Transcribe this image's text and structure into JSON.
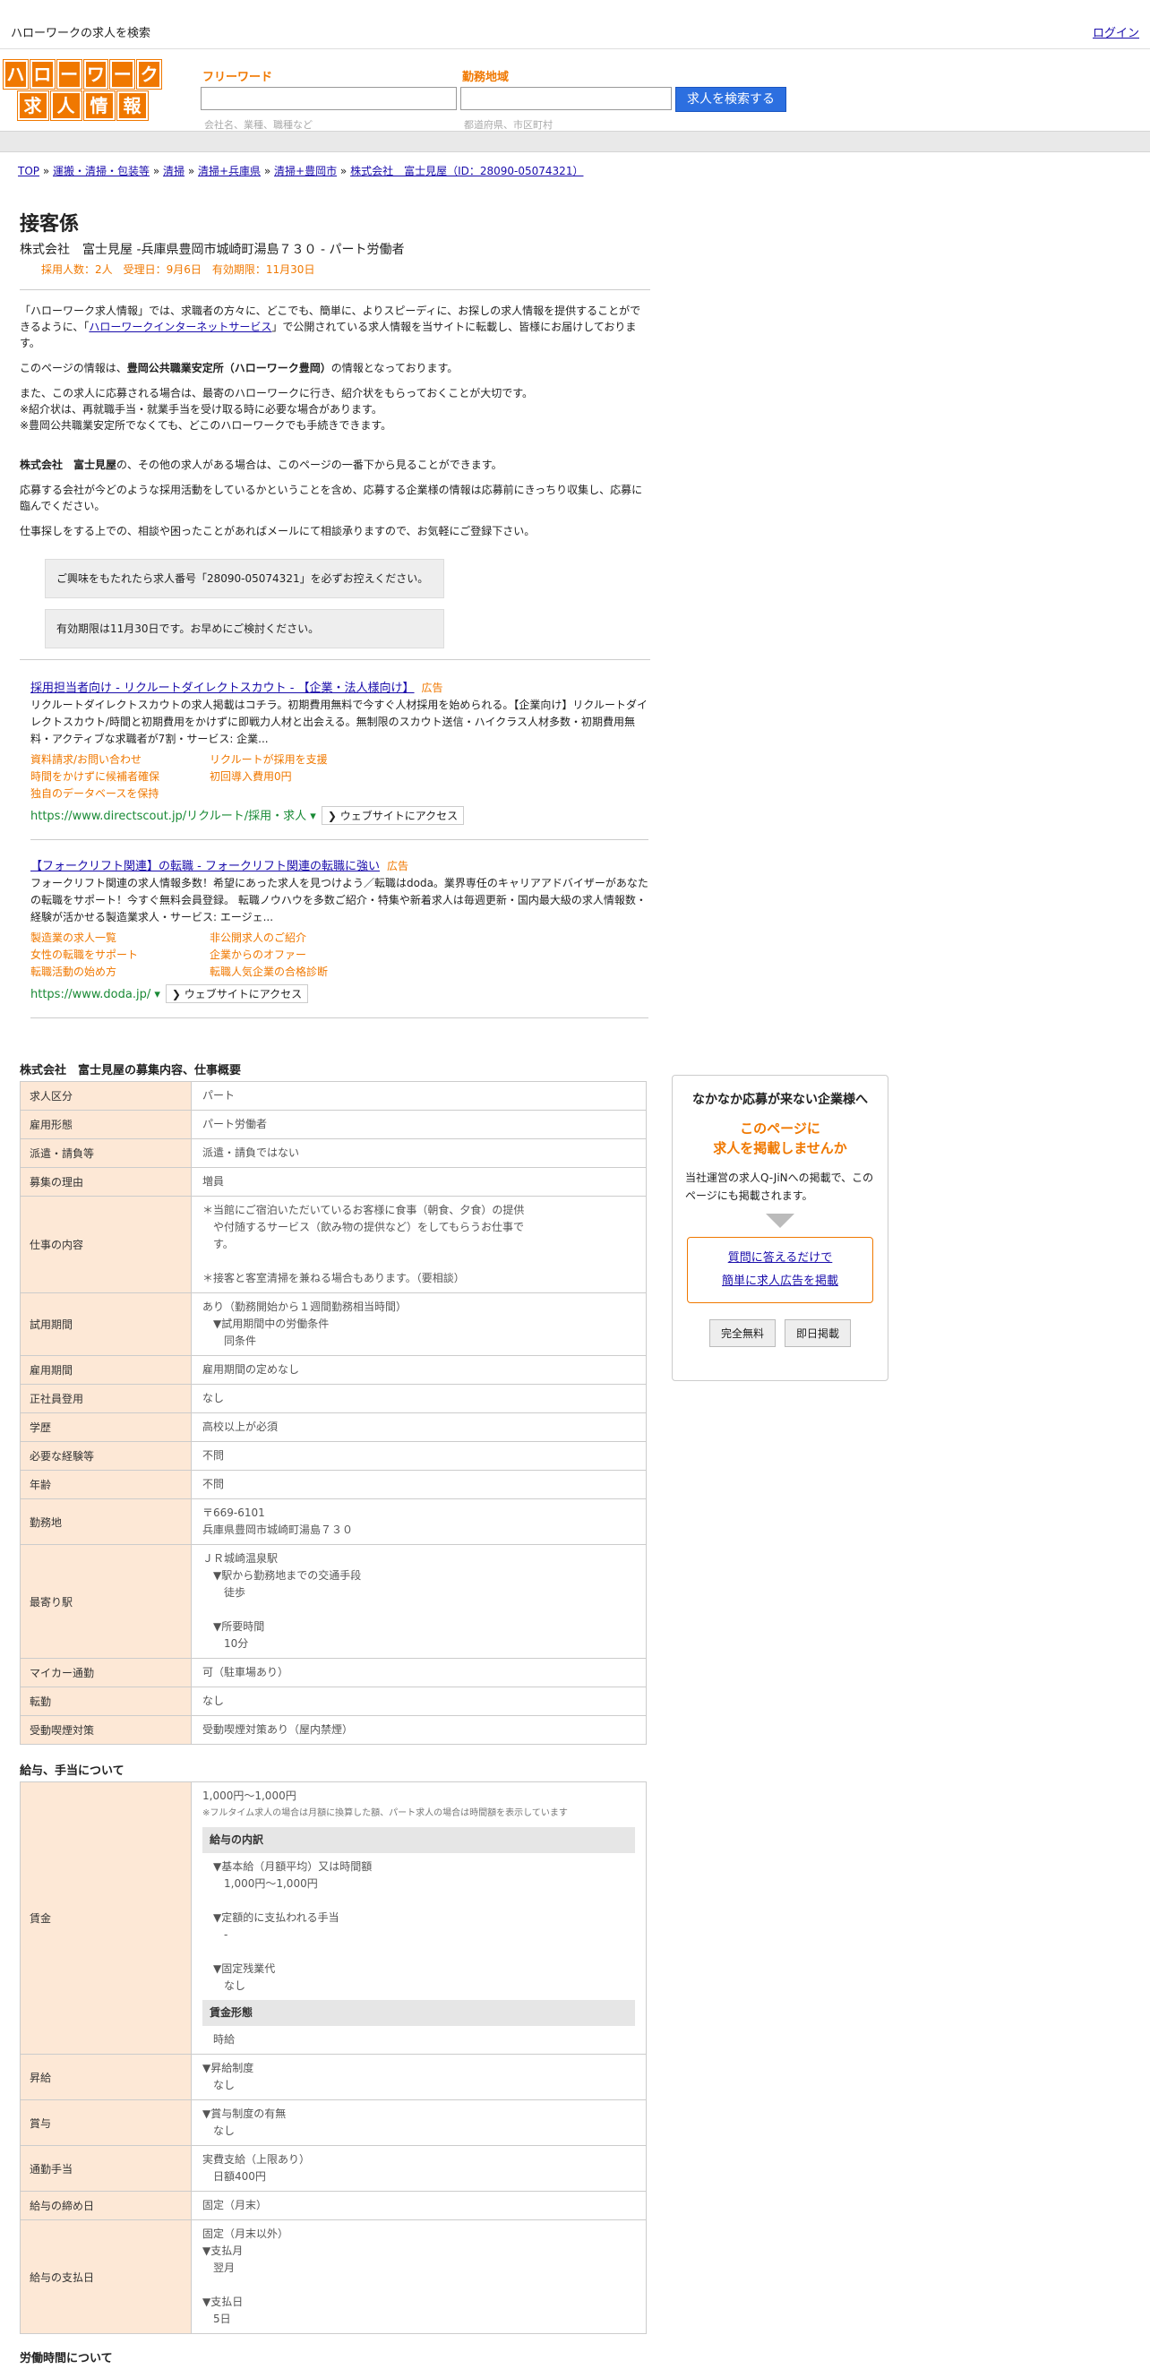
{
  "topbar": {
    "title": "ハローワークの求人を検索",
    "login": "ログイン"
  },
  "logo": {
    "row1": [
      "ハ",
      "ロ",
      "ー",
      "ワ",
      "ー",
      "ク"
    ],
    "row2": [
      "求",
      "人",
      "情",
      "報"
    ]
  },
  "search": {
    "freeword_label": "フリーワード",
    "freeword_placeholder": "会社名、業種、職種など",
    "area_label": "勤務地域",
    "area_placeholder": "都道府県、市区町村",
    "button": "求人を検索する"
  },
  "breadcrumb": [
    "TOP",
    "運搬・清掃・包装等",
    "清掃",
    "清掃+兵庫県",
    "清掃+豊岡市",
    "株式会社　富士見屋（ID：28090-05074321）"
  ],
  "job": {
    "title": "接客係",
    "subtitle": "株式会社　富士見屋 -兵庫県豊岡市城崎町湯島７３０ - パート労働者",
    "meta": "採用人数：2人　受理日：9月6日　有効期限：11月30日"
  },
  "intro": {
    "p1a": "「ハローワーク求人情報」では、求職者の方々に、どこでも、簡単に、よりスピーディに、お探しの求人情報を提供することができるように、「",
    "p1link": "ハローワークインターネットサービス",
    "p1b": "」で公開されている求人情報を当サイトに転載し、皆様にお届けしております。",
    "p2a": "このページの情報は、",
    "p2b": "豊岡公共職業安定所（ハローワーク豊岡）",
    "p2c": "の情報となっております。",
    "p3": [
      "また、この求人に応募される場合は、最寄のハローワークに行き、紹介状をもらっておくことが大切です。",
      "※紹介状は、再就職手当・就業手当を受け取る時に必要な場合があります。",
      "※豊岡公共職業安定所でなくても、どこのハローワークでも手続きできます。"
    ],
    "p4a": "株式会社　富士見屋",
    "p4b": "の、その他の求人がある場合は、このページの一番下から見ることができます。",
    "p5": "応募する会社が今どのような採用活動をしているかということを含め、応募する企業様の情報は応募前にきっちり収集し、応募に臨んでください。",
    "p6": "仕事探しをする上での、相談や困ったことがあればメールにて相談承りますので、お気軽にご登録下さい。",
    "notice1": "ご興味をもたれたら求人番号「28090-05074321」を必ずお控えください。",
    "notice2": "有効期限は11月30日です。お早めにご検討ください。"
  },
  "ads": [
    {
      "title": "採用担当者向け - リクルートダイレクトスカウト - 【企業・法人様向け】",
      "tag": "広告",
      "desc": "リクルートダイレクトスカウトの求人掲載はコチラ。初期費用無料で今すぐ人材採用を始められる。【企業向け】リクルートダイレクトスカウト/時間と初期費用をかけずに即戦力人材と出会える。無制限のスカウト送信・ハイクラス人材多数・初期費用無料・アクティブな求職者が7割・サービス: 企業...",
      "links": [
        "資料請求/お問い合わせ",
        "リクルートが採用を支援",
        "時間をかけずに候補者確保",
        "初回導入費用0円",
        "独自のデータベースを保持"
      ],
      "url": "https://www.directscout.jp/リクルート/採用・求人",
      "visit": "❯ ウェブサイトにアクセス"
    },
    {
      "title": "【フォークリフト関連】の転職 - フォークリフト関連の転職に強い",
      "tag": "広告",
      "desc": "フォークリフト関連の求人情報多数！希望にあった求人を見つけよう／転職はdoda。業界専任のキャリアアドバイザーがあなたの転職をサポート！今すぐ無料会員登録。 転職ノウハウを多数ご紹介・特集や新着求人は毎週更新・国内最大級の求人情報数・経験が活かせる製造業求人・サービス: エージェ...",
      "links": [
        "製造業の求人一覧",
        "非公開求人のご紹介",
        "女性の転職をサポート",
        "企業からのオファー",
        "転職活動の始め方",
        "転職人気企業の合格診断"
      ],
      "url": "https://www.doda.jp/",
      "visit": "❯ ウェブサイトにアクセス"
    }
  ],
  "section1": {
    "title": "株式会社　富士見屋の募集内容、仕事概要",
    "rows": [
      {
        "k": "求人区分",
        "v": [
          "パート"
        ]
      },
      {
        "k": "雇用形態",
        "v": [
          "パート労働者"
        ]
      },
      {
        "k": "派遣・請負等",
        "v": [
          "派遣・請負ではない"
        ]
      },
      {
        "k": "募集の理由",
        "v": [
          "増員"
        ]
      },
      {
        "k": "仕事の内容",
        "v": [
          "＊当館にご宿泊いただいているお客様に食事（朝食、夕食）の提供",
          "　や付随するサービス（飲み物の提供など）をしてもらうお仕事で",
          "　す。",
          "",
          "＊接客と客室清掃を兼ねる場合もあります。（要相談）"
        ]
      },
      {
        "k": "試用期間",
        "v": [
          "あり（勤務開始から１週間勤務相当時間）",
          "　▼試用期間中の労働条件",
          "　　同条件"
        ]
      },
      {
        "k": "雇用期間",
        "v": [
          "雇用期間の定めなし"
        ]
      },
      {
        "k": "正社員登用",
        "v": [
          "なし"
        ]
      },
      {
        "k": "学歴",
        "v": [
          "高校以上が必須"
        ]
      },
      {
        "k": "必要な経験等",
        "v": [
          "不問"
        ]
      },
      {
        "k": "年齢",
        "v": [
          "不問"
        ]
      },
      {
        "k": "勤務地",
        "v": [
          "〒669-6101",
          "兵庫県豊岡市城崎町湯島７３０"
        ]
      },
      {
        "k": "最寄り駅",
        "v": [
          "ＪＲ城崎温泉駅",
          "　▼駅から勤務地までの交通手段",
          "　　徒歩",
          "",
          "　▼所要時間",
          "　　10分"
        ]
      },
      {
        "k": "マイカー通勤",
        "v": [
          "可（駐車場あり）"
        ]
      },
      {
        "k": "転勤",
        "v": [
          "なし"
        ]
      },
      {
        "k": "受動喫煙対策",
        "v": [
          "受動喫煙対策あり（屋内禁煙）"
        ]
      }
    ]
  },
  "section2": {
    "title": "給与、手当について",
    "wage_label": "賃金",
    "wage_main": "1,000円〜1,000円",
    "wage_note": "※フルタイム求人の場合は月額に換算した額、パート求人の場合は時間額を表示しています",
    "breakdown_hdr": "給与の内訳",
    "breakdown": [
      "▼基本給（月額平均）又は時間額",
      "　1,000円〜1,000円",
      "",
      "▼定額的に支払われる手当",
      "　-",
      "",
      "▼固定残業代",
      "　なし"
    ],
    "form_hdr": "賃金形態",
    "form_val": "時給",
    "rows": [
      {
        "k": "昇給",
        "v": [
          "▼昇給制度",
          "　なし"
        ]
      },
      {
        "k": "賞与",
        "v": [
          "▼賞与制度の有無",
          "　なし"
        ]
      },
      {
        "k": "通勤手当",
        "v": [
          "実費支給（上限あり）",
          "　日額400円"
        ]
      },
      {
        "k": "給与の締め日",
        "v": [
          "固定（月末）"
        ]
      },
      {
        "k": "給与の支払日",
        "v": [
          "固定（月末以外）",
          "▼支払月",
          "　翌月",
          "",
          "▼支払日",
          "　5日"
        ]
      }
    ]
  },
  "section3": {
    "title": "労働時間について"
  },
  "sidebar": {
    "heading": "なかなか応募が来ない企業様へ",
    "offer1": "このページに",
    "offer2": "求人を掲載しませんか",
    "desc": "当社運営の求人Q-JiNへの掲載で、このページにも掲載されます。",
    "link1": "質問に答えるだけで",
    "link2": "簡単に求人広告を掲載",
    "btn1": "完全無料",
    "btn2": "即日掲載"
  }
}
